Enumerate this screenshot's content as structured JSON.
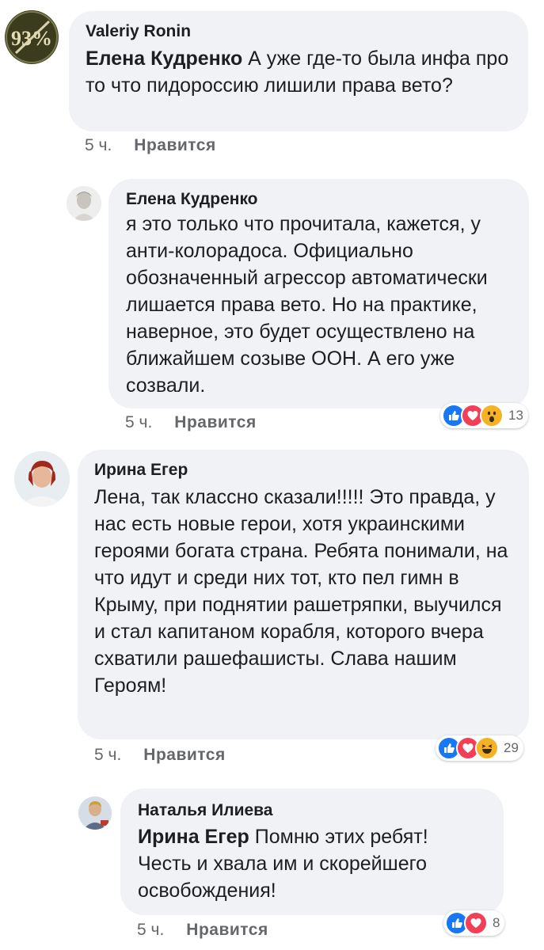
{
  "comments": [
    {
      "author": "Valeriy Ronin",
      "mention": "Елена Кудренко",
      "text": " А уже где-то была инфа про то что пидороссию лишили права вето?",
      "avatar_text": "93%",
      "time": "5 ч.",
      "like_label": "Нравится"
    },
    {
      "author": "Елена Кудренко",
      "text": "я это только что прочитала, кажется, у анти-колорадоса. Официально обозначенный агрессор автоматически лишается права вето. Но на практике, наверное, это будет осуществлено на ближайшем созыве ООН. А его уже созвали.",
      "time": "5 ч.",
      "like_label": "Нравится",
      "reactions": {
        "icons": [
          "like-icon",
          "love-icon",
          "wow-icon"
        ],
        "count": "13"
      }
    },
    {
      "author": "Ирина Егер",
      "text": "Лена, так классно сказали!!!!! Это правда, у нас есть новые герои, хотя украинскими героями богата страна. Ребята понимали, на что идут и среди них тот, кто пел гимн в Крыму, при поднятии рашетряпки, выучился и стал капитаном корабля, которого вчера схватили рашефашисты. Слава нашим Героям!",
      "time": "5 ч.",
      "like_label": "Нравится",
      "reactions": {
        "icons": [
          "like-icon",
          "love-icon",
          "haha-icon"
        ],
        "count": "29"
      }
    },
    {
      "author": "Наталья Илиева",
      "mention": "Ирина Егер",
      "text": " Помню этих ребят! Честь и хвала им и скорейшего освобождения!",
      "time": "5 ч.",
      "like_label": "Нравится",
      "reactions": {
        "icons": [
          "like-icon",
          "love-icon"
        ],
        "count": "8"
      }
    }
  ],
  "colors": {
    "bubble": "#f0f2f5",
    "meta": "#65676b",
    "like": "#1877f2",
    "love": "#f33e58",
    "emoji": "#f7b125"
  }
}
